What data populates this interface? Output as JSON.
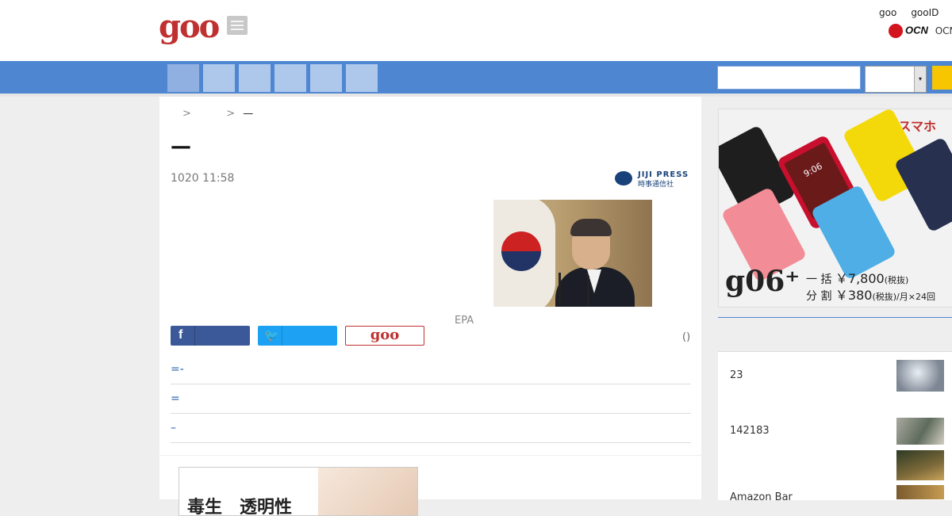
{
  "header": {
    "logo_text": "goo",
    "news_icon": "newspaper-icon",
    "links": [
      "goo",
      "gooID"
    ],
    "ocn_mark": "OCN",
    "ocn_label": "OCN"
  },
  "nav": {
    "tab_count": 6,
    "active_tab": 0,
    "colors": {
      "bar": "#4f86d1",
      "tab": "#aec8ec",
      "active_tab": "#8fb0e0",
      "search_button": "#f7c600"
    }
  },
  "search": {
    "input_value": "",
    "select_value": "",
    "arrow_icon": "▾"
  },
  "breadcrumb": {
    "separator_1": ">",
    "separator_2": ">",
    "current": "—"
  },
  "article": {
    "title": "—",
    "date": "1020 11:58",
    "source_en": "JIJI PRESS",
    "source_ja": "時事通信社",
    "photo_caption": "EPA",
    "share_count": "()",
    "related": [
      "=-",
      "=",
      "–"
    ]
  },
  "share": {
    "facebook_icon": "f",
    "twitter_icon": "🐦",
    "goo_label": "goo"
  },
  "ads": {
    "left_text": "毒生　透明性",
    "right": {
      "brand": "gooのスマホ",
      "model": "g06⁺",
      "row1_prefix": "一 括",
      "row1_price": "￥7,800",
      "row1_suffix": "(税抜)",
      "row2_prefix": "分 割",
      "row2_price": "￥380",
      "row2_suffix": "(税抜)/月×24回",
      "phone_screen_time": "9:06"
    }
  },
  "sidebar": {
    "items": [
      "23",
      "142183",
      "Amazon Bar"
    ]
  }
}
